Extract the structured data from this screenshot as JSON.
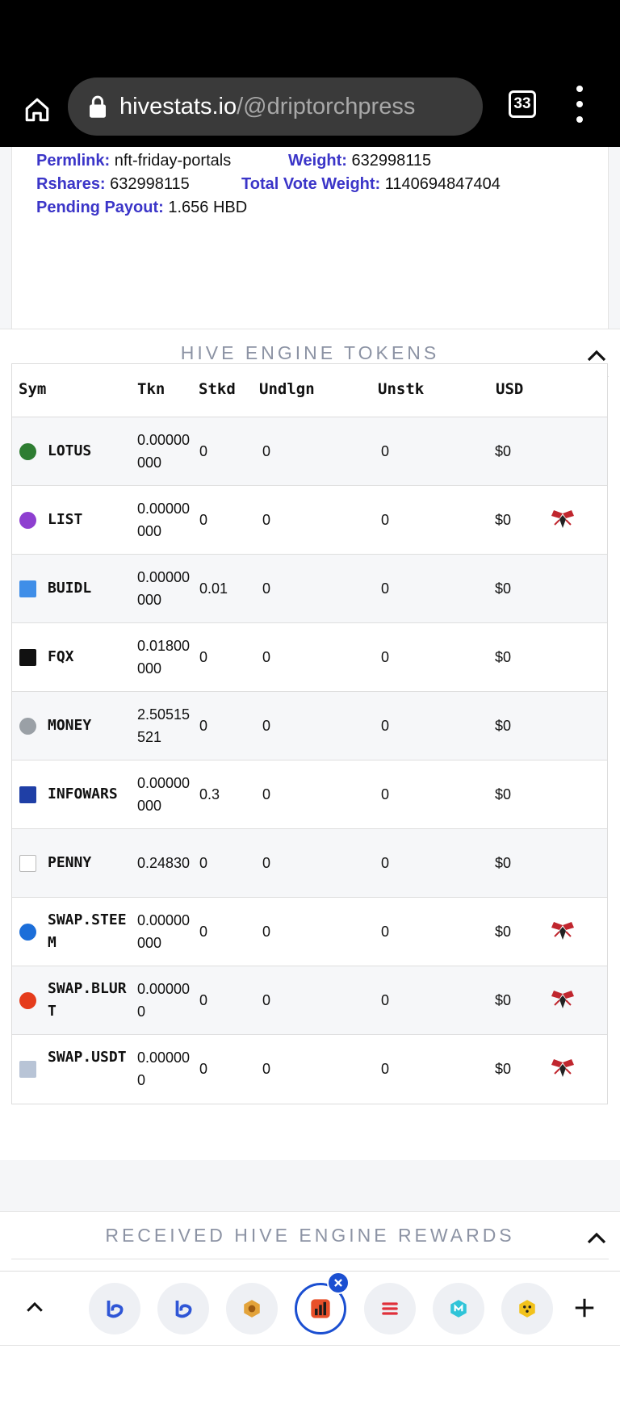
{
  "browser": {
    "url_host": "hivestats.io",
    "url_path": "/@driptorchpress",
    "tab_count": "33",
    "icons": [
      "home-icon",
      "lock-icon",
      "tabs-icon",
      "more-vert-icon"
    ]
  },
  "vote": {
    "permlink_label": "Permlink:",
    "permlink_value": "nft-friday-portals",
    "weight_label": "Weight:",
    "weight_value": "632998115",
    "rshares_label": "Rshares:",
    "rshares_value": "632998115",
    "total_vote_weight_label": "Total Vote Weight:",
    "total_vote_weight_value": "1140694847404",
    "pending_payout_label": "Pending Payout:",
    "pending_payout_value": "1.656 HBD"
  },
  "hive_engine": {
    "title": "HIVE ENGINE TOKENS",
    "columns": [
      "Sym",
      "Tkn",
      "Stkd",
      "Undlgn",
      "Unstk",
      "USD"
    ],
    "rows": [
      {
        "sym": "LOTUS",
        "tkn": "0.00000000",
        "stkd": "0",
        "undlgn": "0",
        "unstk": "0",
        "usd": "$0",
        "bee": false
      },
      {
        "sym": "LIST",
        "tkn": "0.00000000",
        "stkd": "0",
        "undlgn": "0",
        "unstk": "0",
        "usd": "$0",
        "bee": true
      },
      {
        "sym": "BUIDL",
        "tkn": "0.00000000",
        "stkd": "0.01",
        "undlgn": "0",
        "unstk": "0",
        "usd": "$0",
        "bee": false
      },
      {
        "sym": "FQX",
        "tkn": "0.01800000",
        "stkd": "0",
        "undlgn": "0",
        "unstk": "0",
        "usd": "$0",
        "bee": false
      },
      {
        "sym": "MONEY",
        "tkn": "2.50515521",
        "stkd": "0",
        "undlgn": "0",
        "unstk": "0",
        "usd": "$0",
        "bee": false
      },
      {
        "sym": "INFOWARS",
        "tkn": "0.00000000",
        "stkd": "0.3",
        "undlgn": "0",
        "unstk": "0",
        "usd": "$0",
        "bee": false
      },
      {
        "sym": "PENNY",
        "tkn": "0.24830",
        "stkd": "0",
        "undlgn": "0",
        "unstk": "0",
        "usd": "$0",
        "bee": false
      },
      {
        "sym": "SWAP.STEEM",
        "tkn": "0.00000000",
        "stkd": "0",
        "undlgn": "0",
        "unstk": "0",
        "usd": "$0",
        "bee": true
      },
      {
        "sym": "SWAP.BLURT",
        "tkn": "0.000000",
        "stkd": "0",
        "undlgn": "0",
        "unstk": "0",
        "usd": "$0",
        "bee": true
      },
      {
        "sym": "SWAP.USDT",
        "tkn": "0.000000",
        "stkd": "0",
        "undlgn": "0",
        "unstk": "0",
        "usd": "$0",
        "bee": true
      }
    ],
    "token_icon_colors": [
      "#2e7d32",
      "#8e3fd0",
      "#3f8ee8",
      "#111111",
      "#9aa0a6",
      "#1f3fa6",
      "#ffffff",
      "#1c6ed9",
      "#e53c1c",
      "#b8c4d6"
    ],
    "bee_color": "#c0262e"
  },
  "rewards_section": {
    "title": "RECEIVED HIVE ENGINE REWARDS"
  },
  "bottom_tabs": {
    "icons": [
      "chevron-up-icon",
      "tab-icon-1",
      "tab-icon-2",
      "tab-icon-3",
      "tab-icon-4-active",
      "tab-icon-5",
      "tab-icon-6",
      "tab-icon-7",
      "add-icon"
    ],
    "accent": "#1b4fd1"
  }
}
